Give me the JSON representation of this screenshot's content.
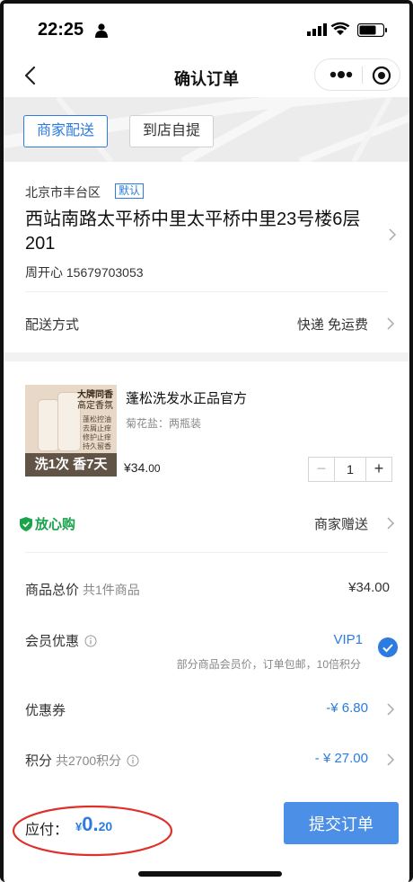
{
  "status_bar": {
    "time": "22:25"
  },
  "nav": {
    "title": "确认订单"
  },
  "delivery_tabs": [
    {
      "label": "商家配送",
      "active": true
    },
    {
      "label": "到店自提",
      "active": false
    }
  ],
  "address": {
    "region": "北京市丰台区",
    "default_tag": "默认",
    "detail": "西站南路太平桥中里太平桥中里23号楼6层201",
    "contact": "周开心 15679703053"
  },
  "shipping": {
    "label": "配送方式",
    "value": "快递 免运费"
  },
  "product": {
    "name": "蓬松洗发水正品官方",
    "spec": "菊花盐：两瓶装",
    "price_int": "¥34.",
    "price_dec": "00",
    "quantity": "1",
    "image_text": {
      "top1": "大牌同香",
      "top2": "高定香氛",
      "features": [
        "蓬松控油",
        "去屑止痒",
        "修护止痒",
        "持久留香"
      ],
      "banner": "洗1次 香7天"
    }
  },
  "assurance": {
    "label": "放心购",
    "gift": "商家赠送"
  },
  "summary": {
    "goods_total": {
      "label": "商品总价",
      "sub": "共1件商品",
      "value": "¥34.00"
    },
    "member": {
      "label": "会员优惠",
      "value": "VIP1",
      "note": "部分商品会员价，订单包邮，10倍积分"
    },
    "coupon": {
      "label": "优惠券",
      "value": "-¥ 6.80"
    },
    "points": {
      "label": "积分",
      "sub": "共2700积分",
      "value": "- ¥ 27.00"
    }
  },
  "checkout": {
    "pay_label": "应付：",
    "currency": "¥",
    "amount_int": "0.",
    "amount_dec": "20",
    "submit_label": "提交订单"
  },
  "colors": {
    "accent": "#2b7be0",
    "assure_green": "#1aa34a",
    "annotation_red": "#e0302a",
    "submit_bg": "#4c8fe6"
  }
}
